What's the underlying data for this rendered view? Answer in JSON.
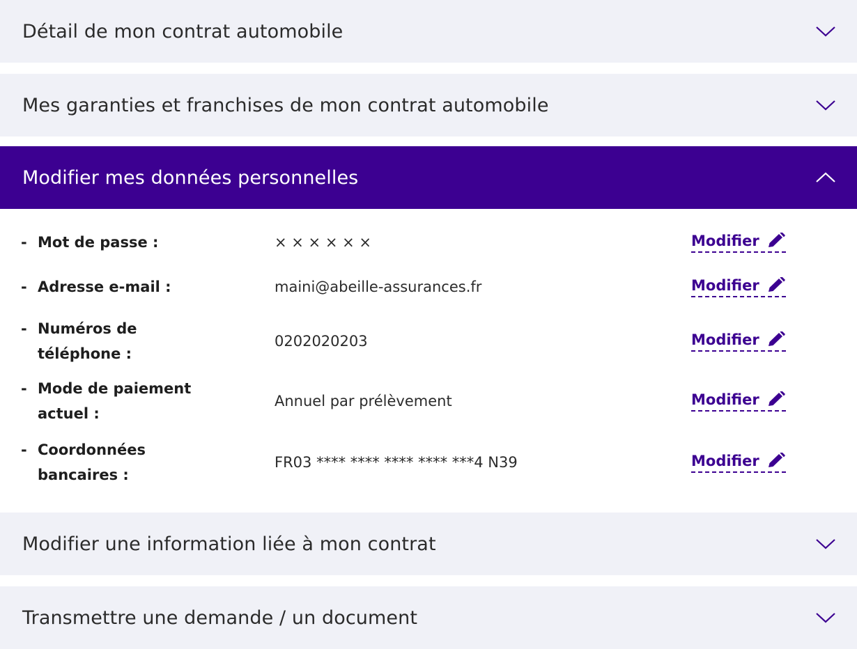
{
  "sections": [
    {
      "title": "Détail de mon contrat automobile",
      "state": "collapsed"
    },
    {
      "title": "Mes garanties et franchises de mon contrat automobile",
      "state": "collapsed"
    },
    {
      "title": "Modifier mes données personnelles",
      "state": "expanded"
    },
    {
      "title": "Modifier une information liée à mon contrat",
      "state": "collapsed"
    },
    {
      "title": "Transmettre une demande / un document",
      "state": "collapsed"
    }
  ],
  "personal_data": {
    "rows": [
      {
        "dash": "-",
        "label": "Mot de passe :",
        "value": "× × × × × ×",
        "action": "Modifier"
      },
      {
        "dash": "-",
        "label": "Adresse e-mail :",
        "value": "maini@abeille-assurances.fr",
        "action": "Modifier"
      },
      {
        "dash": "-",
        "label": "Numéros de téléphone :",
        "value": "0202020203",
        "action": "Modifier"
      },
      {
        "dash": "-",
        "label": "Mode de paiement actuel :",
        "value": "Annuel par prélèvement",
        "action": "Modifier"
      },
      {
        "dash": "-",
        "label": "Coordonnées bancaires :",
        "value": "FR03 **** **** **** **** ***4 N39",
        "action": "Modifier"
      }
    ]
  },
  "colors": {
    "accent": "#3c0091",
    "header_bg": "#f0f1f7",
    "text": "#2b2b2b"
  },
  "icons": {
    "collapsed": "chevron-down-icon",
    "expanded": "chevron-up-icon",
    "edit": "pencil-icon"
  }
}
